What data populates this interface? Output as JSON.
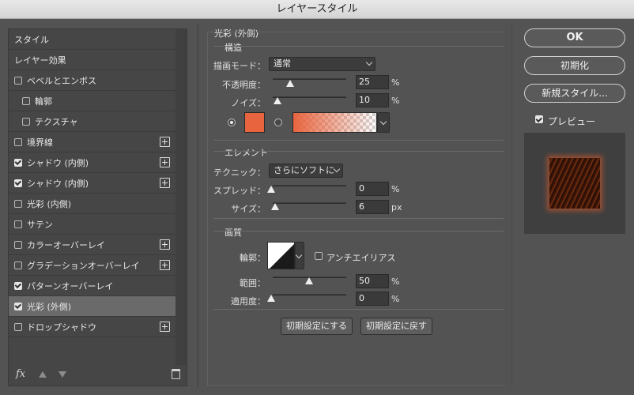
{
  "window": {
    "title": "レイヤースタイル"
  },
  "style_list": {
    "items": [
      {
        "label": "スタイル",
        "checkbox": false,
        "checked": false,
        "plus": false,
        "indent": false,
        "selected": false
      },
      {
        "label": "レイヤー効果",
        "checkbox": false,
        "checked": false,
        "plus": false,
        "indent": false,
        "selected": false
      },
      {
        "label": "ベベルとエンボス",
        "checkbox": true,
        "checked": false,
        "plus": false,
        "indent": false,
        "selected": false
      },
      {
        "label": "輪郭",
        "checkbox": true,
        "checked": false,
        "plus": false,
        "indent": true,
        "selected": false
      },
      {
        "label": "テクスチャ",
        "checkbox": true,
        "checked": false,
        "plus": false,
        "indent": true,
        "selected": false
      },
      {
        "label": "境界線",
        "checkbox": true,
        "checked": false,
        "plus": true,
        "indent": false,
        "selected": false
      },
      {
        "label": "シャドウ (内側)",
        "checkbox": true,
        "checked": true,
        "plus": true,
        "indent": false,
        "selected": false
      },
      {
        "label": "シャドウ (内側)",
        "checkbox": true,
        "checked": true,
        "plus": true,
        "indent": false,
        "selected": false
      },
      {
        "label": "光彩 (内側)",
        "checkbox": true,
        "checked": false,
        "plus": false,
        "indent": false,
        "selected": false
      },
      {
        "label": "サテン",
        "checkbox": true,
        "checked": false,
        "plus": false,
        "indent": false,
        "selected": false
      },
      {
        "label": "カラーオーバーレイ",
        "checkbox": true,
        "checked": false,
        "plus": true,
        "indent": false,
        "selected": false
      },
      {
        "label": "グラデーションオーバーレイ",
        "checkbox": true,
        "checked": false,
        "plus": true,
        "indent": false,
        "selected": false
      },
      {
        "label": "パターンオーバーレイ",
        "checkbox": true,
        "checked": true,
        "plus": false,
        "indent": false,
        "selected": false
      },
      {
        "label": "光彩 (外側)",
        "checkbox": true,
        "checked": true,
        "plus": false,
        "indent": false,
        "selected": true
      },
      {
        "label": "ドロップシャドウ",
        "checkbox": true,
        "checked": false,
        "plus": true,
        "indent": false,
        "selected": false
      }
    ],
    "footer": {
      "fx_label": "fx"
    }
  },
  "outer_glow": {
    "title": "光彩 (外側)",
    "structure": {
      "title": "構造",
      "blend_mode_label": "描画モード：",
      "blend_mode_value": "通常",
      "opacity_label": "不透明度：",
      "opacity_value": "25",
      "opacity_unit": "%",
      "opacity_level": 0.25,
      "noise_label": "ノイズ：",
      "noise_value": "10",
      "noise_unit": "%",
      "noise_level": 0.1,
      "color": "#e8643f"
    },
    "elements": {
      "title": "エレメント",
      "technique_label": "テクニック：",
      "technique_value": "さらにソフトに",
      "spread_label": "スプレッド：",
      "spread_value": "0",
      "spread_unit": "%",
      "spread_level": 0,
      "size_label": "サイズ：",
      "size_value": "6",
      "size_unit": "px",
      "size_level": 0.04
    },
    "quality": {
      "title": "画質",
      "contour_label": "輪郭：",
      "antialias_label": "アンチエイリアス",
      "range_label": "範囲：",
      "range_value": "50",
      "range_unit": "%",
      "range_level": 0.5,
      "jitter_label": "適用度：",
      "jitter_value": "0",
      "jitter_unit": "%",
      "jitter_level": 0
    },
    "buttons": {
      "make_default": "初期設定にする",
      "reset_default": "初期設定に戻す"
    }
  },
  "side_buttons": {
    "ok": "OK",
    "reset": "初期化",
    "new_style": "新規スタイル...",
    "preview_label": "プレビュー",
    "preview_checked": true
  }
}
